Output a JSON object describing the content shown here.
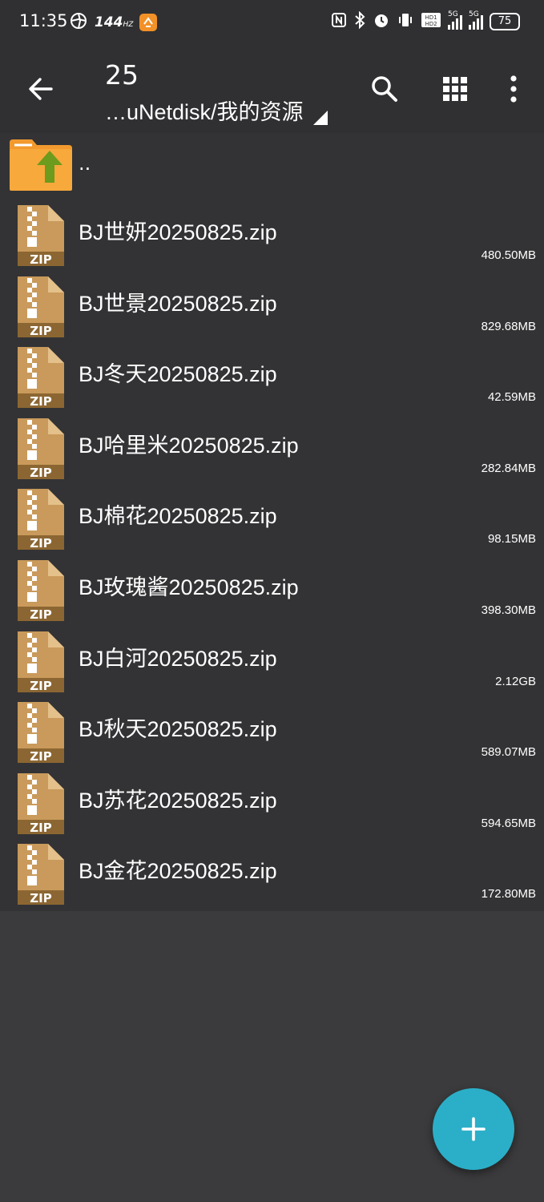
{
  "status_bar": {
    "time": "11:35",
    "refresh_rate": "144",
    "refresh_unit": "HZ",
    "battery": "75",
    "icons": [
      "hotspot-icon",
      "app-badge-icon",
      "nfc-icon",
      "bluetooth-icon",
      "alarm-icon",
      "vibrate-icon",
      "hd-icon",
      "signal-5g-icon",
      "signal-5g-icon",
      "battery-icon"
    ]
  },
  "app_bar": {
    "title": "25",
    "path": "…uNetdisk/我的资源",
    "icons": [
      "back-arrow-icon",
      "search-icon",
      "grid-view-icon",
      "more-vert-icon"
    ]
  },
  "parent_dir": {
    "label": ".."
  },
  "files": [
    {
      "name": "BJ世妍20250825.zip",
      "size": "480.50MB"
    },
    {
      "name": "BJ世景20250825.zip",
      "size": "829.68MB"
    },
    {
      "name": "BJ冬天20250825.zip",
      "size": "42.59MB"
    },
    {
      "name": "BJ哈里米20250825.zip",
      "size": "282.84MB"
    },
    {
      "name": "BJ棉花20250825.zip",
      "size": "98.15MB"
    },
    {
      "name": "BJ玫瑰酱20250825.zip",
      "size": "398.30MB"
    },
    {
      "name": "BJ白河20250825.zip",
      "size": "2.12GB"
    },
    {
      "name": "BJ秋天20250825.zip",
      "size": "589.07MB"
    },
    {
      "name": "BJ苏花20250825.zip",
      "size": "594.65MB"
    },
    {
      "name": "BJ金花20250825.zip",
      "size": "172.80MB"
    }
  ],
  "zip_icon_label": "ZIP",
  "fab": {
    "icon": "plus-icon"
  },
  "colors": {
    "background": "#3b3b3d",
    "list_background": "#333335",
    "accent": "#2bafc8",
    "folder": "#f29a2e",
    "zip": "#c99a5b"
  }
}
